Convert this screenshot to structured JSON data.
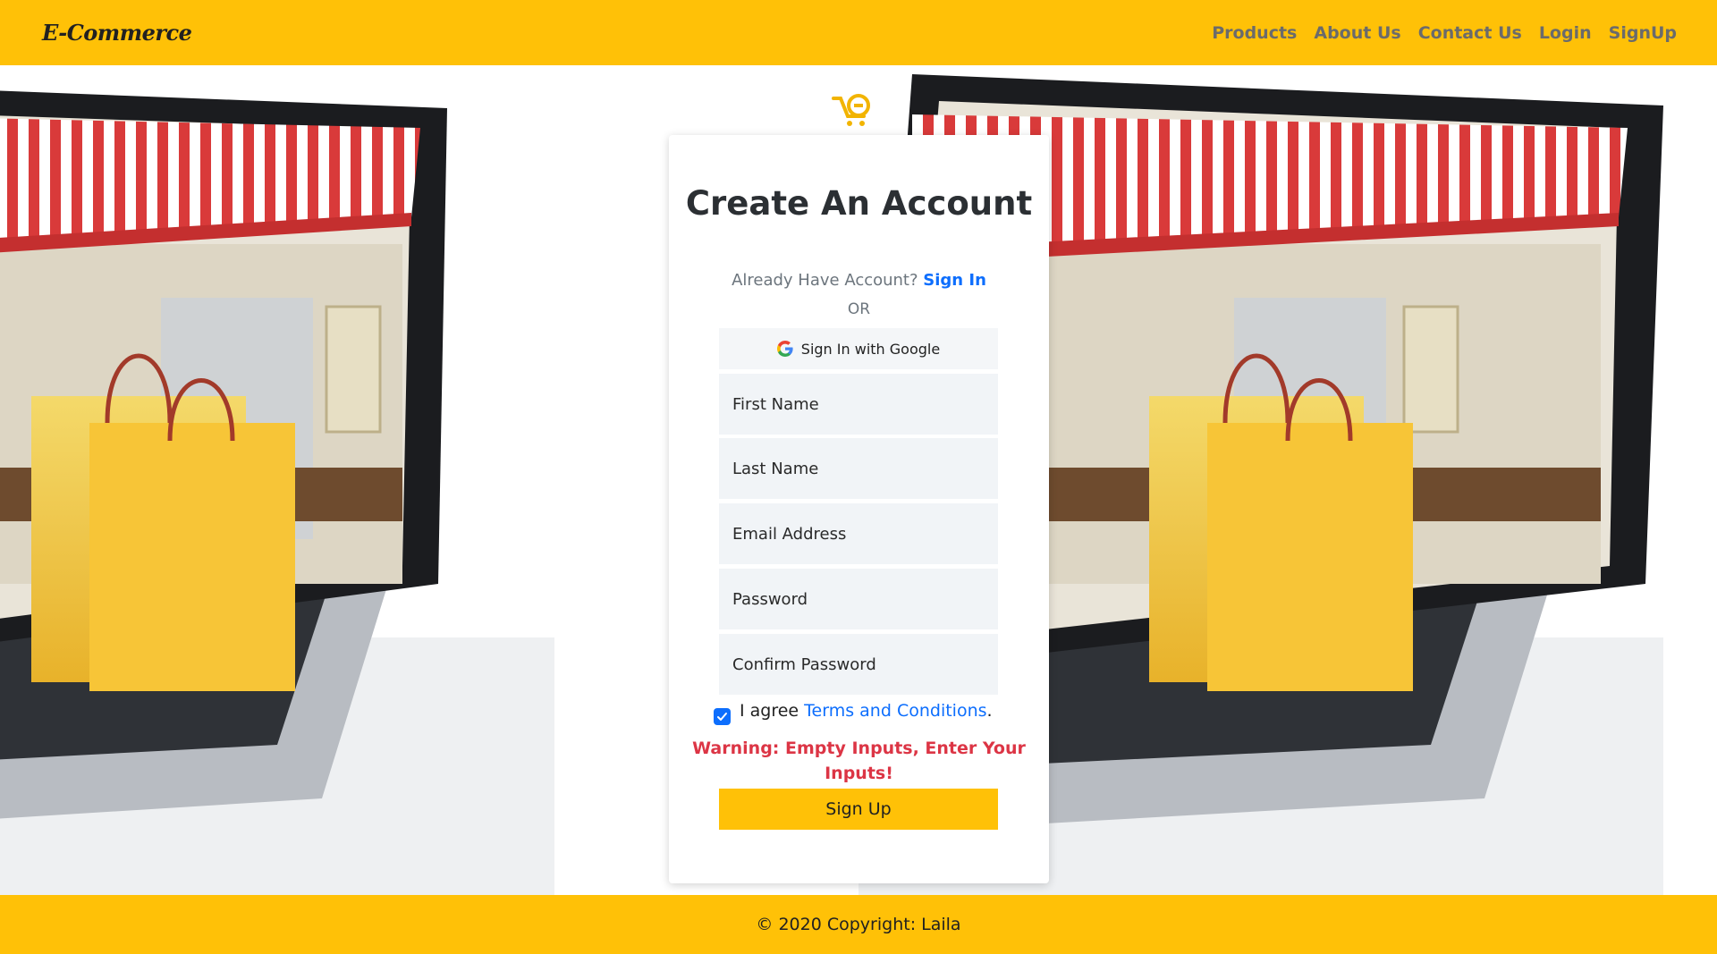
{
  "header": {
    "brand": "E-Commerce",
    "nav": [
      "Products",
      "About Us",
      "Contact Us",
      "Login",
      "SignUp"
    ]
  },
  "form": {
    "title": "Create An Account",
    "already_text": "Already Have Account?",
    "signin_label": "Sign In",
    "or_text": "OR",
    "google_label": "Sign In with Google",
    "fields": {
      "first_name": "First Name",
      "last_name": "Last Name",
      "email": "Email Address",
      "password": "Password",
      "confirm_password": "Confirm Password"
    },
    "agree_prefix": "I agree",
    "terms_label": "Terms and Conditions",
    "agree_suffix": ".",
    "agree_checked": true,
    "warning": "Warning: Empty Inputs, Enter Your Inputs!",
    "submit_label": "Sign Up"
  },
  "footer": {
    "copyright": "© 2020 Copyright: Laila"
  },
  "colors": {
    "primary": "#ffc107",
    "link": "#0d6efd",
    "warning": "#dc3545"
  }
}
